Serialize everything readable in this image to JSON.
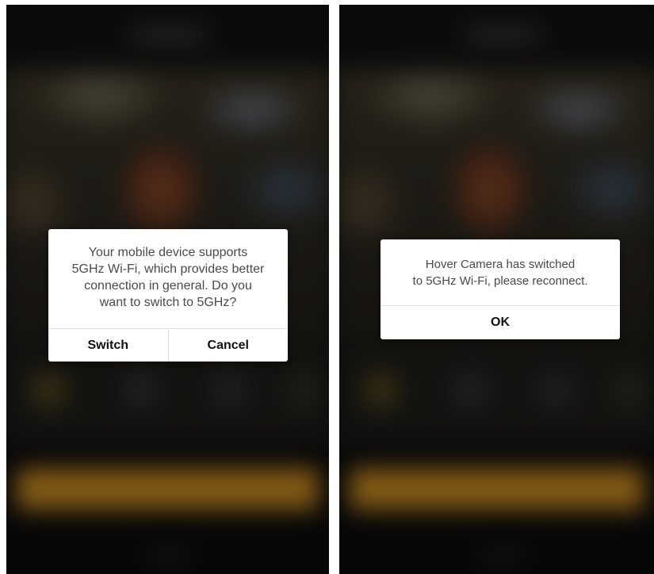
{
  "left_screen": {
    "dialog": {
      "message": "Your mobile device supports\n5GHz Wi-Fi, which provides better\nconnection in general. Do you\nwant to switch to 5GHz?",
      "switch_label": "Switch",
      "cancel_label": "Cancel"
    }
  },
  "right_screen": {
    "dialog": {
      "message": "Hover Camera has switched\nto 5GHz Wi-Fi, please reconnect.",
      "ok_label": "OK"
    }
  },
  "colors": {
    "dialog_background": "#ffffff",
    "message_text": "#4a4a4a",
    "button_text": "#111111",
    "accent_background_button": "#c88a22"
  }
}
